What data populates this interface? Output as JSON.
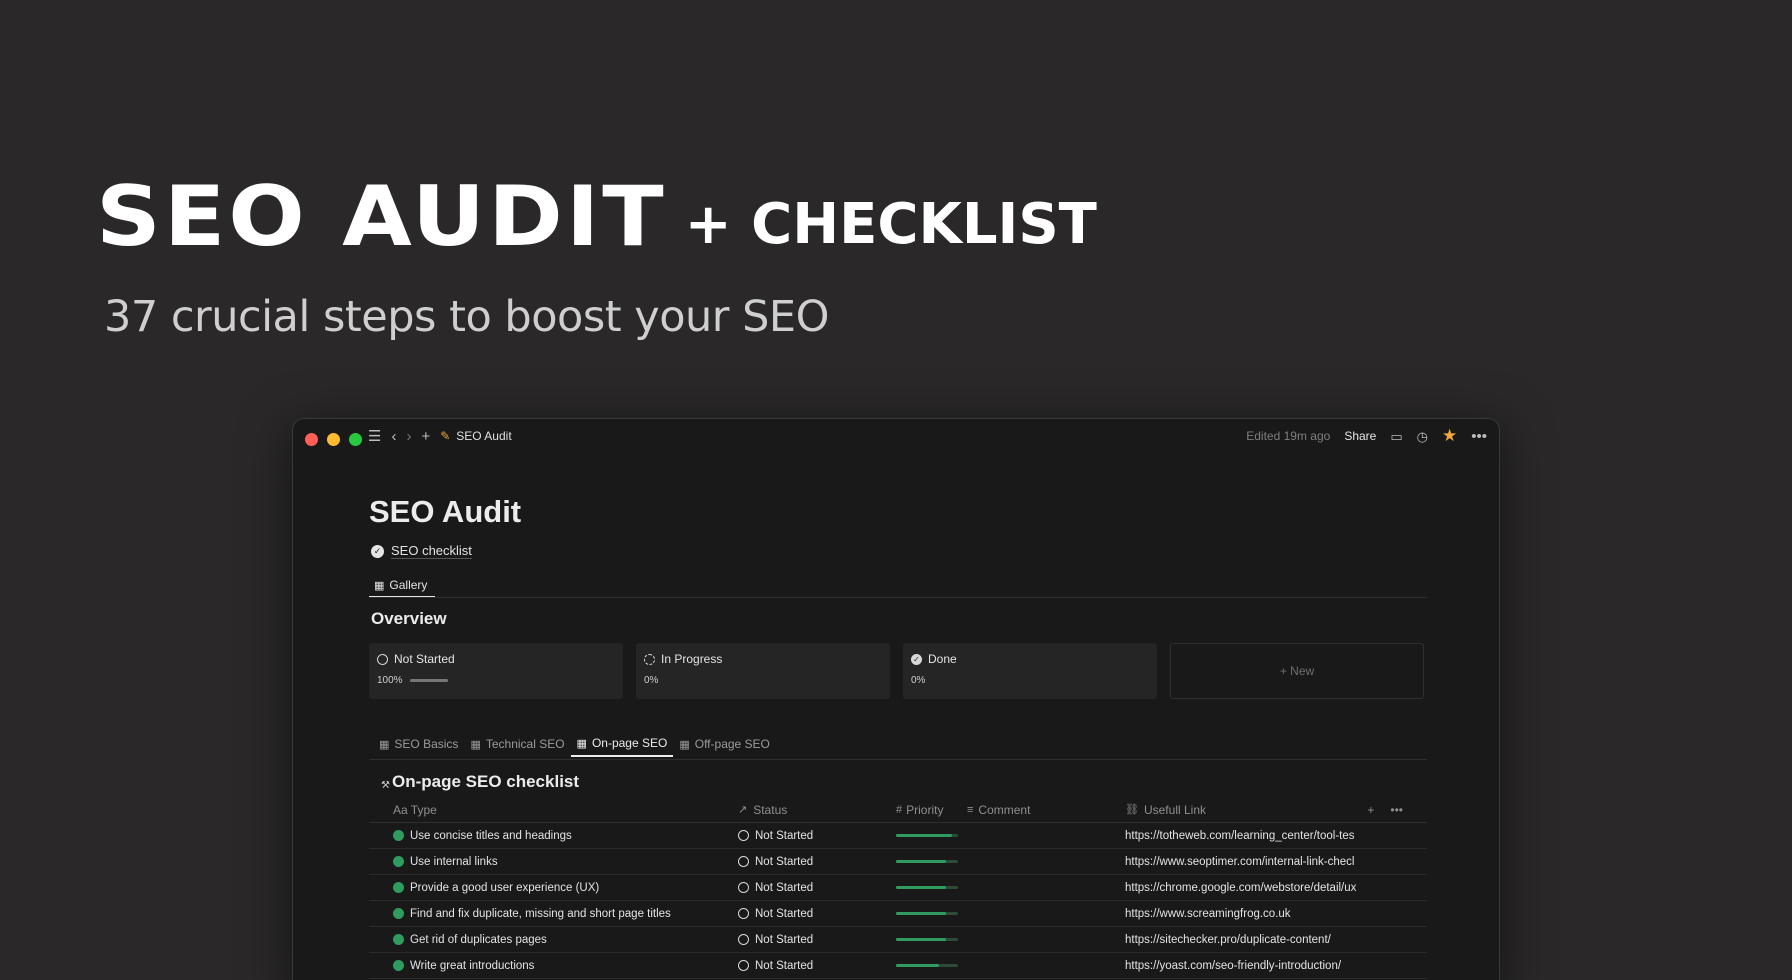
{
  "hero": {
    "title_main": "SEO AUDIT",
    "title_suffix": "+ CHECKLIST",
    "tagline": "37 crucial steps to boost your SEO"
  },
  "window": {
    "breadcrumb_title": "SEO Audit",
    "edited": "Edited 19m ago",
    "share_label": "Share",
    "icons": [
      "sidebar-toggle-icon",
      "back-arrow-icon",
      "forward-arrow-icon",
      "plus-icon",
      "page-emoji-icon",
      "comment-icon",
      "history-clock-icon",
      "favorite-star-icon",
      "more-dots-icon"
    ],
    "accent_star_color": "#f0a83c"
  },
  "page": {
    "title": "SEO Audit",
    "checklist_link": "SEO checklist",
    "gallery_tab": "Gallery",
    "overview_heading": "Overview"
  },
  "cards": [
    {
      "label": "Not Started",
      "pct": "100%",
      "progress": 1.0
    },
    {
      "label": "In Progress",
      "pct": "0%",
      "progress": 0.0
    },
    {
      "label": "Done",
      "pct": "0%",
      "progress": 0.0
    }
  ],
  "new_card_label": "+ New",
  "view_tabs": [
    {
      "label": "SEO Basics",
      "active": false
    },
    {
      "label": "Technical SEO",
      "active": false
    },
    {
      "label": "On-page SEO",
      "active": true
    },
    {
      "label": "Off-page SEO",
      "active": false
    }
  ],
  "section_title": "On-page SEO checklist",
  "table": {
    "headers": {
      "type": "Aa Type",
      "status": "Status",
      "priority": "Priority",
      "comment": "Comment",
      "link": "Usefull Link"
    },
    "rows": [
      {
        "type": "Use concise titles and headings",
        "status": "Not Started",
        "priority": 0.9,
        "link": "https://totheweb.com/learning_center/tool-tes"
      },
      {
        "type": "Use internal links",
        "status": "Not Started",
        "priority": 0.8,
        "link": "https://www.seoptimer.com/internal-link-checl"
      },
      {
        "type": "Provide a good user experience (UX)",
        "status": "Not Started",
        "priority": 0.8,
        "link": "https://chrome.google.com/webstore/detail/ux"
      },
      {
        "type": "Find and fix duplicate, missing and short page titles",
        "status": "Not Started",
        "priority": 0.8,
        "link": "https://www.screamingfrog.co.uk"
      },
      {
        "type": "Get rid of duplicates pages",
        "status": "Not Started",
        "priority": 0.8,
        "link": "https://sitechecker.pro/duplicate-content/"
      },
      {
        "type": "Write great introductions",
        "status": "Not Started",
        "priority": 0.7,
        "link": "https://yoast.com/seo-friendly-introduction/"
      }
    ]
  }
}
